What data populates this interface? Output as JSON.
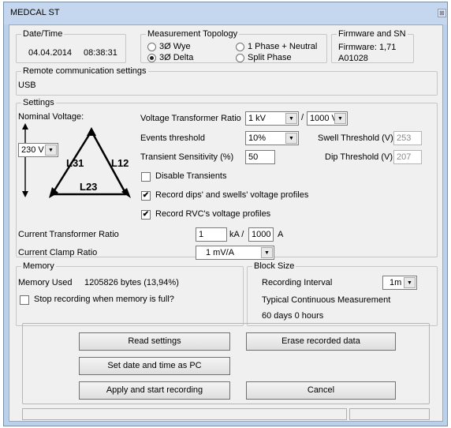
{
  "window": {
    "title": "MEDCAL ST",
    "close_glyph": "⊠"
  },
  "datetime": {
    "legend": "Date/Time",
    "date": "04.04.2014",
    "time": "08:38:31"
  },
  "topology": {
    "legend": "Measurement Topology",
    "options": [
      {
        "label": "3Ø Wye",
        "selected": false
      },
      {
        "label": "3Ø Delta",
        "selected": true
      },
      {
        "label": "1 Phase + Neutral",
        "selected": false
      },
      {
        "label": "Split Phase",
        "selected": false
      }
    ]
  },
  "firmware": {
    "legend": "Firmware and SN",
    "firmware": "Firmware: 1,71",
    "serial": "A01028"
  },
  "remote": {
    "legend": "Remote communication settings",
    "value": "USB"
  },
  "settings": {
    "legend": "Settings",
    "nominal_voltage_label": "Nominal Voltage:",
    "nominal_voltage_value": "230 V",
    "diagram": {
      "l31": "L31",
      "l12": "L12",
      "l23": "L23"
    },
    "vt_ratio_label": "Voltage Transformer Ratio",
    "vt_primary": "1 kV",
    "vt_sep": "/",
    "vt_secondary": "1000 V",
    "events_threshold_label": "Events threshold",
    "events_threshold_value": "10%",
    "swell_label": "Swell Threshold (V)",
    "swell_value": "253",
    "transient_label": "Transient Sensitivity (%)",
    "transient_value": "50",
    "dip_label": "Dip Threshold (V)",
    "dip_value": "207",
    "disable_transients": {
      "label": "Disable Transients",
      "checked": false
    },
    "record_dips": {
      "label": "Record dips' and swells' voltage profiles",
      "checked": true
    },
    "record_rvc": {
      "label": "Record RVC's voltage profiles",
      "checked": true
    },
    "ct_ratio_label": "Current Transformer Ratio",
    "ct_primary": "1",
    "ct_unit1": "kA /",
    "ct_secondary": "1000",
    "ct_unit2": "A",
    "clamp_label": "Current Clamp Ratio",
    "clamp_value": "1 mV/A"
  },
  "memory": {
    "legend": "Memory",
    "used_label": "Memory Used",
    "used_value": "1205826 bytes  (13,94%)",
    "stop_when_full": {
      "label": "Stop recording when memory is full?",
      "checked": false
    }
  },
  "block": {
    "legend": "Block Size",
    "interval_label": "Recording Interval",
    "interval_value": "1m",
    "typical_label": "Typical Continuous Measurement",
    "typical_value": "60 days 0 hours"
  },
  "buttons": {
    "read_settings": "Read settings",
    "erase": "Erase recorded data",
    "set_date": "Set date and time as PC",
    "apply": "Apply and start recording",
    "cancel": "Cancel"
  },
  "icons": {
    "dropdown": "▼",
    "check": "✔"
  }
}
